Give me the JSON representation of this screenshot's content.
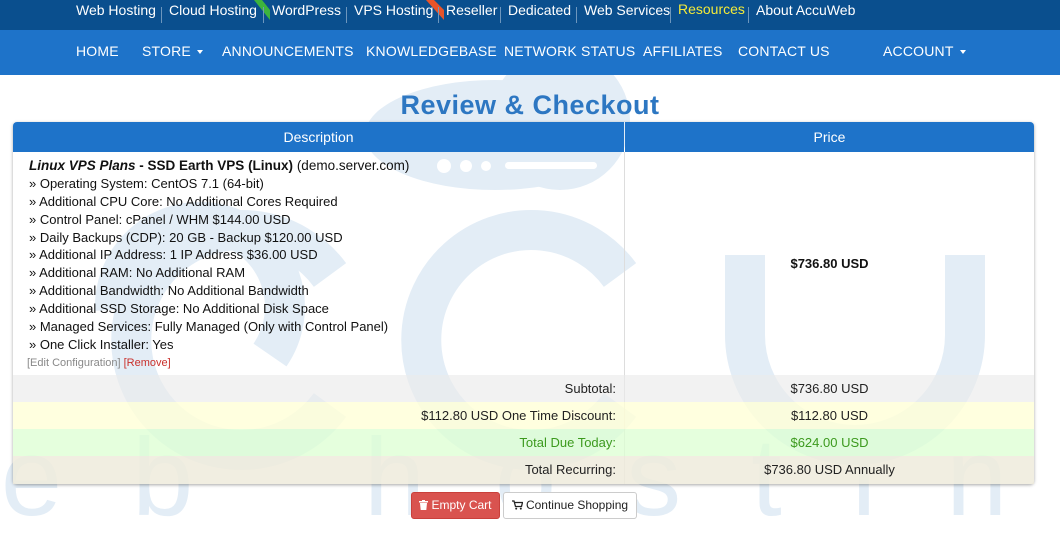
{
  "topnav": {
    "items": [
      "Web Hosting",
      "Cloud Hosting",
      "WordPress",
      "VPS Hosting",
      "Reseller",
      "Dedicated",
      "Web Services",
      "Resources",
      "About AccuWeb"
    ],
    "active": "Resources",
    "ribbon_colors": [
      "#3db33d",
      "#e8542a"
    ]
  },
  "mainnav": {
    "items": [
      "HOME",
      "STORE",
      "ANNOUNCEMENTS",
      "KNOWLEDGEBASE",
      "NETWORK STATUS",
      "AFFILIATES",
      "CONTACT US",
      "ACCOUNT"
    ]
  },
  "watermark": {
    "line1": "accu",
    "line2": "web hosting"
  },
  "page": {
    "title": "Review & Checkout"
  },
  "cart": {
    "headers": {
      "description": "Description",
      "price": "Price"
    },
    "item": {
      "product_type": "Linux VPS Plans",
      "product_sep": " - ",
      "product_name": "SSD Earth VPS (Linux)",
      "domain": " (demo.server.com)",
      "options": [
        "» Operating System: CentOS 7.1 (64-bit)",
        "» Additional CPU Core: No Additional Cores Required",
        "» Control Panel: cPanel / WHM $144.00 USD",
        "» Daily Backups (CDP): 20 GB - Backup $120.00 USD",
        "» Additional IP Address: 1 IP Address $36.00 USD",
        "» Additional RAM: No Additional RAM",
        "» Additional Bandwidth: No Additional Bandwidth",
        "» Additional SSD Storage: No Additional Disk Space",
        "» Managed Services: Fully Managed (Only with Control Panel)",
        "» One Click Installer: Yes"
      ],
      "edit_link": "[Edit Configuration]",
      "remove_link": "[Remove]",
      "price": "$736.80 USD"
    },
    "totals": {
      "subtotal_label": "Subtotal:",
      "subtotal": "$736.80 USD",
      "discount_label": "$112.80 USD One Time Discount:",
      "discount": "$112.80 USD",
      "due_label": "Total Due Today:",
      "due": "$624.00 USD",
      "recurring_label": "Total Recurring:",
      "recurring": "$736.80 USD Annually"
    },
    "buttons": {
      "empty": "Empty Cart",
      "continue": "Continue Shopping"
    }
  },
  "colors": {
    "topbar": "#0a4f8e",
    "nav": "#1e73c9",
    "accent": "#2d77c2",
    "active_link": "#f3ea39",
    "danger": "#d9534f",
    "success": "#3c9a1e"
  }
}
